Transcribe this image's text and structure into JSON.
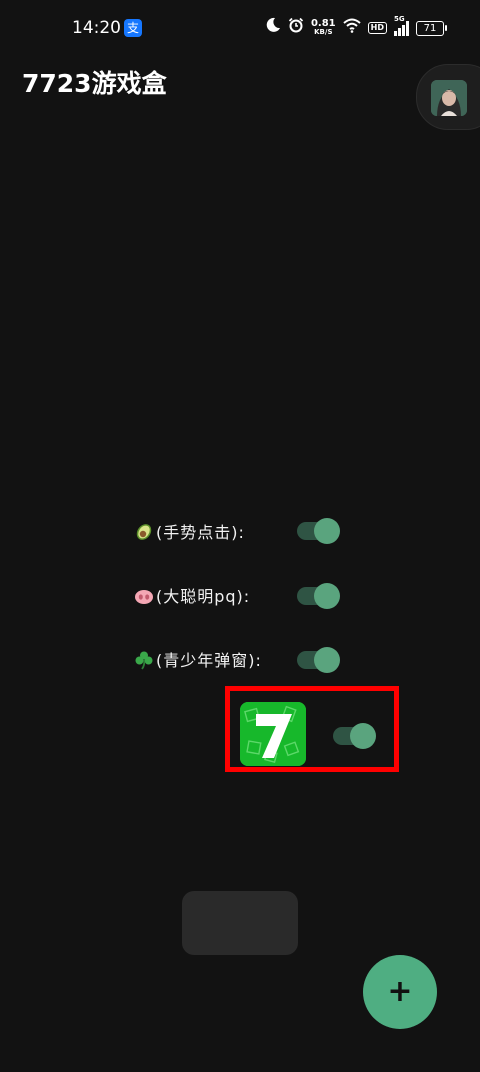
{
  "status_bar": {
    "time": "14:20",
    "net_speed_value": "0.81",
    "net_speed_unit": "KB/S",
    "hd_label": "HD",
    "network_type": "5G",
    "battery_level": "71",
    "icons": [
      "alipay-icon",
      "moon-icon",
      "alarm-icon",
      "wifi-icon",
      "signal-icon",
      "battery-icon"
    ]
  },
  "header": {
    "title": "7723游戏盒"
  },
  "toggles": [
    {
      "emoji": "avocado",
      "label": "(手势点击):",
      "enabled": true
    },
    {
      "emoji": "pig-nose",
      "label": "(大聪明pq):",
      "enabled": true
    },
    {
      "emoji": "shamrock",
      "label": "(青少年弹窗):",
      "enabled": true
    }
  ],
  "app_toggle": {
    "app_icon": "7723-app-icon",
    "app_icon_text": "7",
    "enabled": true
  },
  "fab": {
    "label": "+"
  },
  "colors": {
    "background": "#121212",
    "accent": "#4fae82",
    "switch_track": "#2f5444",
    "switch_thumb": "#5aa47e",
    "highlight": "#ff0000",
    "app_icon_green": "#17b82b"
  }
}
